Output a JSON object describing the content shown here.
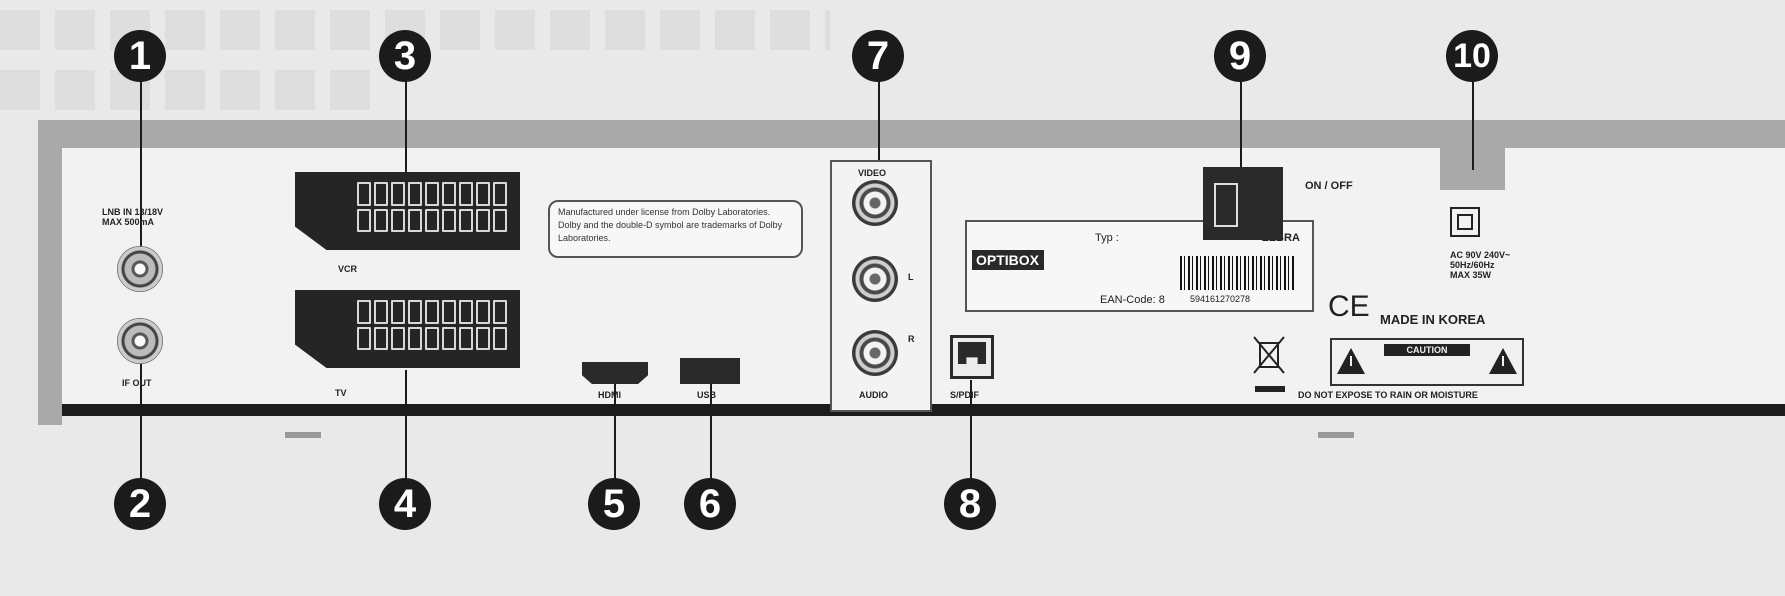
{
  "callouts": [
    "1",
    "2",
    "3",
    "4",
    "5",
    "6",
    "7",
    "8",
    "9",
    "10"
  ],
  "connectors": {
    "lnb_in": "LNB IN 13/18V\nMAX 500mA",
    "if_out": "IF OUT",
    "vcr": "VCR",
    "tv": "TV",
    "hdmi": "HDMI",
    "usb": "USB",
    "video": "VIDEO",
    "audio_l": "L",
    "audio_r": "R",
    "audio": "AUDIO",
    "spdif": "S/PDIF",
    "on_off": "ON / OFF"
  },
  "notice": "Manufactured under license from Dolby Laboratories. Dolby and the double-D symbol are trademarks of Dolby Laboratories.",
  "type_label": {
    "brand": "OPTIBOX",
    "typ_label": "Typ :",
    "typ_value": "ZEBRA",
    "ean_label": "EAN-Code: 8",
    "ean_value": "594161270278"
  },
  "power_rating": "AC 90V 240V~\n50Hz/60Hz\nMAX 35W",
  "ce_mark": "CE",
  "made_in": "MADE IN KOREA",
  "caution": "CAUTION",
  "warning": "DO NOT EXPOSE TO RAIN OR MOISTURE",
  "icons": [
    "power-class-icon",
    "weee-bin-icon",
    "warning-triangle-icon",
    "scart-connector-icon",
    "rca-connector-icon",
    "coax-connector-icon",
    "hdmi-port-icon",
    "usb-port-icon",
    "optical-port-icon",
    "rocker-switch-icon"
  ]
}
